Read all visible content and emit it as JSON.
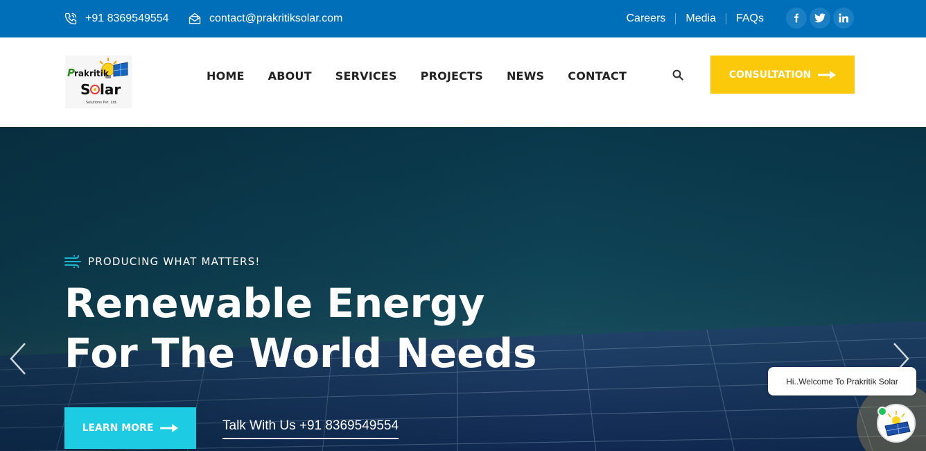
{
  "topbar": {
    "phone": "+91 8369549554",
    "email": "contact@prakritiksolar.com",
    "links": [
      "Careers",
      "Media",
      "FAQs"
    ],
    "socials": [
      "facebook-icon",
      "twitter-icon",
      "linkedin-icon"
    ]
  },
  "header": {
    "logo": {
      "line1": "Prakritik",
      "line2": "Solar",
      "line3": "Solutions Pvt. Ltd."
    },
    "nav": [
      "HOME",
      "ABOUT",
      "SERVICES",
      "PROJECTS",
      "NEWS",
      "CONTACT"
    ],
    "cta_label": "CONSULTATION"
  },
  "hero": {
    "tagline": "PRODUCING WHAT MATTERS!",
    "headline_line1": "Renewable Energy",
    "headline_line2": "For The World Needs",
    "learn_more": "LEARN MORE",
    "talk": "Talk With Us +91 8369549554"
  },
  "chat": {
    "welcome": "Hi..Welcome To Prakritik Solar"
  },
  "colors": {
    "topbar": "#006fb9",
    "cta": "#fcc90a",
    "learn_more": "#1dcbe3",
    "online_dot": "#23c35b"
  }
}
